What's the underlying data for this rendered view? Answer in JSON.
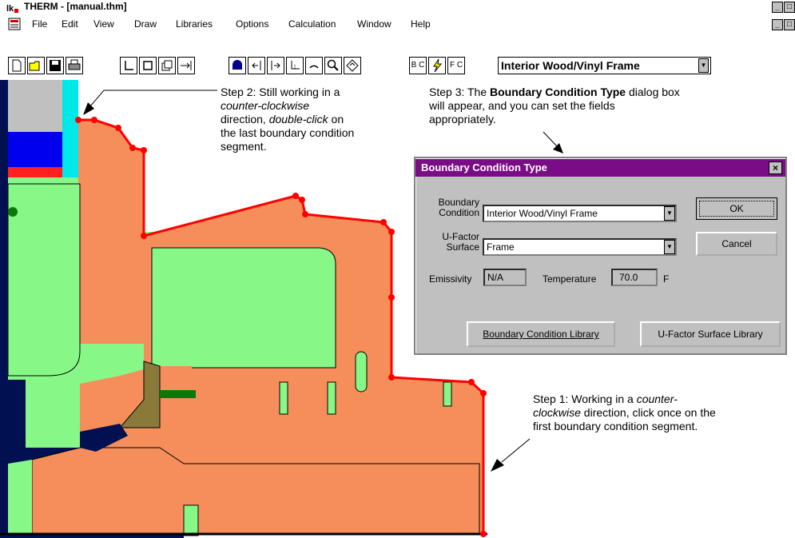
{
  "window": {
    "title": "THERM - [manual.thm]",
    "controls": [
      "_",
      "□"
    ]
  },
  "menu": {
    "items": [
      "File",
      "Edit",
      "View",
      "Draw",
      "Libraries",
      "Options",
      "Calculation",
      "Window",
      "Help"
    ]
  },
  "toolbar": {
    "bc_button": "B C",
    "uf_button": "F C",
    "bc_combo_value": "Interior Wood/Vinyl Frame"
  },
  "annotations": {
    "step2_line1": "Step 2: Still working in a",
    "step2_line2": "counter-clockwise",
    "step2_line3a": "direction, ",
    "step2_line3b": "double-click",
    "step2_line3c": " on",
    "step2_line4": "the last boundary condition",
    "step2_line5": "segment.",
    "step3_line1a": "Step 3: The ",
    "step3_line1b": "Boundary Condition Type",
    "step3_line1c": " dialog box",
    "step3_line2": "will appear, and you can set the fields",
    "step3_line3": "appropriately.",
    "step1_line1a": "Step 1: Working in a ",
    "step1_line1b": "counter-",
    "step1_line2a": "clockwise",
    "step1_line2b": " direction, click once on the",
    "step1_line3": "first boundary condition segment."
  },
  "dialog": {
    "title": "Boundary Condition Type",
    "close": "×",
    "bc_label_1": "Boundary",
    "bc_label_2": "Condition",
    "bc_value": "Interior Wood/Vinyl Frame",
    "uf_label_1": "U-Factor",
    "uf_label_2": "Surface",
    "uf_value": "Frame",
    "emissivity_label": "Emissivity",
    "emissivity_value": "N/A",
    "temperature_label": "Temperature",
    "temperature_value": "70.0",
    "temperature_unit": "F",
    "ok": "OK",
    "cancel": "Cancel",
    "bc_library": "Boundary Condition Library",
    "uf_library": "U-Factor Surface Library"
  },
  "colors": {
    "frame_orange": "#f58e5b",
    "light_green": "#87f887",
    "boundary_red": "#ff0000",
    "dark_navy": "#001050",
    "dialog_title": "#7a0c86"
  }
}
